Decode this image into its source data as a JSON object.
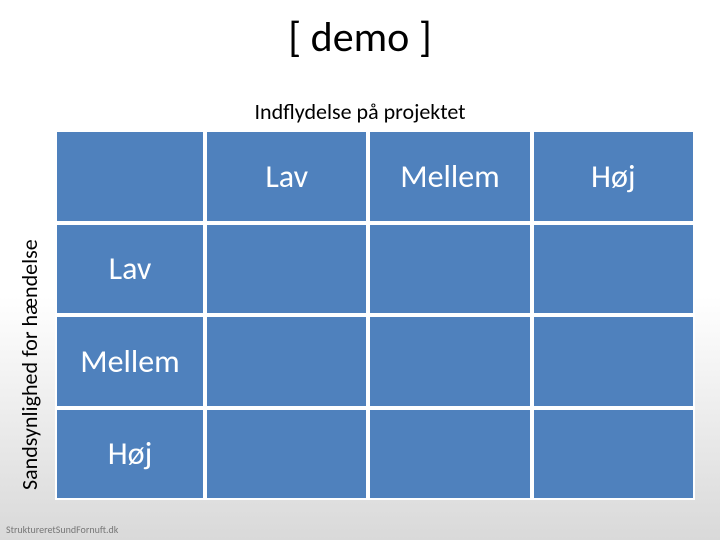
{
  "title": "[ demo ]",
  "axis": {
    "columns_label": "Indflydelse på projektet",
    "rows_label": "Sandsynlighed for hændelse"
  },
  "chart_data": {
    "type": "table",
    "title": "[ demo ]",
    "xlabel": "Indflydelse på projektet",
    "ylabel": "Sandsynlighed for hændelse",
    "columns": [
      "Lav",
      "Mellem",
      "Høj"
    ],
    "rows": [
      "Lav",
      "Mellem",
      "Høj"
    ],
    "cells": [
      [
        "",
        "",
        ""
      ],
      [
        "",
        "",
        ""
      ],
      [
        "",
        "",
        ""
      ]
    ]
  },
  "footer": "StruktureretSundFornuft.dk"
}
